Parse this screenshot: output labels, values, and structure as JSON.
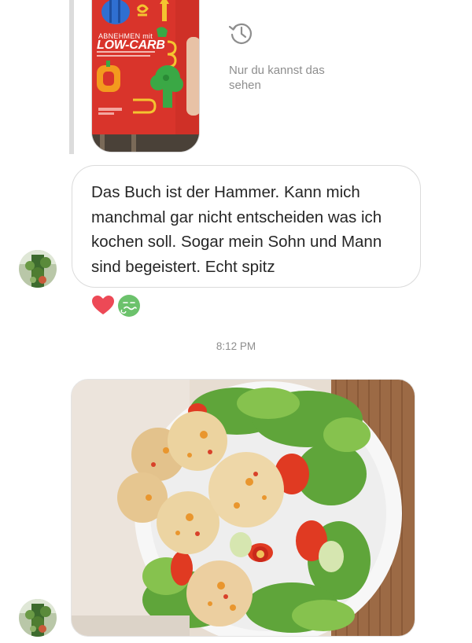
{
  "story_reply": {
    "book_subtitle": "ABNEHMEN mit",
    "book_title": "LOW-CARB",
    "private_note": "Nur du kannst das sehen",
    "private_icon": "history-icon"
  },
  "message": {
    "text": "Das Buch ist der Hammer.  Kann mich manchmal gar nicht entscheiden was ich kochen soll. Sogar mein Sohn und Mann sind begeistert. Echt spitz",
    "reactions": [
      "heart",
      "sleepy-face"
    ]
  },
  "timestamp": "8:12 PM",
  "colors": {
    "bubble_border": "#dbdbdb",
    "text": "#262626",
    "meta_text": "#8e8e8e",
    "heart": "#ed4956",
    "reaction_green": "#5cb85c",
    "book_red": "#d9342b"
  }
}
